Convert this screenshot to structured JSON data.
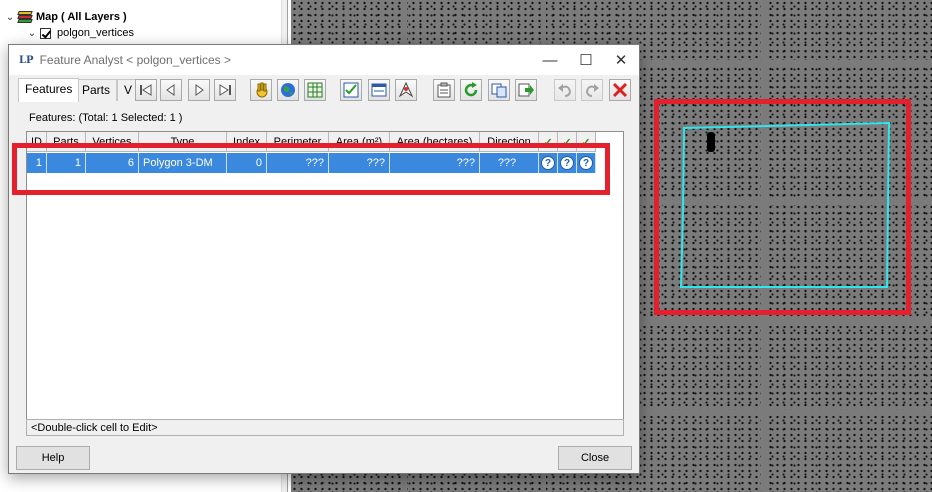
{
  "layer_tree": {
    "root_label": "Map ( All Layers )",
    "layer_label": "polgon_vertices"
  },
  "dialog": {
    "app_logo": "LP",
    "title": "Feature Analyst  < polgon_vertices >",
    "minimize_glyph": "—",
    "maximize_glyph": "☐",
    "close_glyph": "✕",
    "tabs": [
      {
        "label": "Features"
      },
      {
        "label": "Parts"
      },
      {
        "label": "V"
      }
    ],
    "summary": "Features: (Total: 1  Selected: 1 )",
    "toolbar_icons": [
      "first-record-icon",
      "previous-record-icon",
      "next-record-icon",
      "last-record-icon",
      "pan-hand-icon",
      "globe-icon",
      "table-icon",
      "check-list-icon",
      "form-icon",
      "pin-icon",
      "properties-icon",
      "refresh-icon",
      "copy-icon",
      "export-icon",
      "undo-icon",
      "redo-icon",
      "delete-icon"
    ],
    "grid": {
      "columns": [
        "ID",
        "Parts",
        "Vertices",
        "Type",
        "Index",
        "Perimeter",
        "Area (m²)",
        "Area (hectares)",
        "Direction",
        "✓",
        "✓",
        "✓"
      ],
      "rows": [
        {
          "id": "1",
          "parts": "1",
          "vertices": "6",
          "type": "Polygon 3-DM",
          "index": "0",
          "perimeter": "???",
          "area_m2": "???",
          "area_ha": "???",
          "direction": "???",
          "q1": "?",
          "q2": "?",
          "q3": "?"
        }
      ]
    },
    "status": "<Double-click cell to Edit>",
    "help_label": "Help",
    "close_label": "Close"
  },
  "colors": {
    "highlight_red": "#e4202f",
    "selection_blue": "#3b88df",
    "polygon_cyan": "#2ee6ee"
  }
}
